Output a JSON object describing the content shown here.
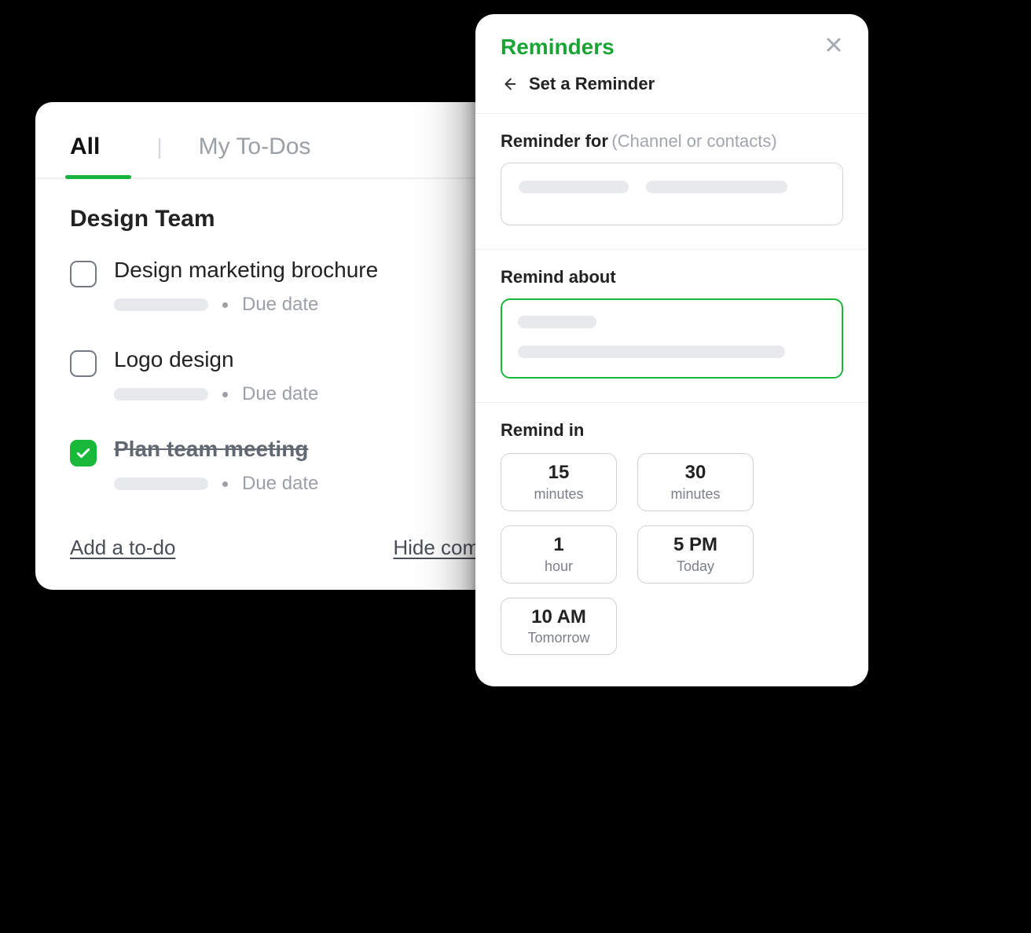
{
  "todos": {
    "tabs": {
      "all": "All",
      "my": "My To-Dos"
    },
    "section_title": "Design Team",
    "items": [
      {
        "title": "Design marketing brochure",
        "due_label": "Due date",
        "done": false
      },
      {
        "title": "Logo design",
        "due_label": "Due date",
        "done": false
      },
      {
        "title": "Plan team meeting",
        "due_label": "Due date",
        "done": true
      }
    ],
    "actions": {
      "add": "Add a to-do",
      "hide": "Hide completed"
    }
  },
  "reminders": {
    "title": "Reminders",
    "back_label": "Set a Reminder",
    "for_label": "Reminder for",
    "for_hint": "(Channel or contacts)",
    "about_label": "Remind about",
    "in_label": "Remind in",
    "options": [
      {
        "big": "15",
        "small": "minutes"
      },
      {
        "big": "30",
        "small": "minutes"
      },
      {
        "big": "1",
        "small": "hour"
      },
      {
        "big": "5 PM",
        "small": "Today"
      },
      {
        "big": "10 AM",
        "small": "Tomorrow"
      }
    ]
  },
  "colors": {
    "accent": "#19b83b"
  }
}
